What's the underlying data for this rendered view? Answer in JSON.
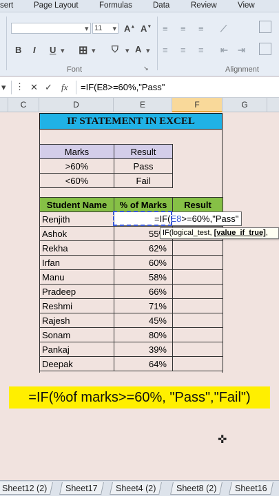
{
  "ribbon_tabs": [
    "sert",
    "Page Layout",
    "Formulas",
    "Data",
    "Review",
    "View"
  ],
  "font_size": "11",
  "group_labels": {
    "font": "Font",
    "alignment": "Alignment"
  },
  "formula_bar": {
    "fx": "fx",
    "formula": "=IF(E8>=60%,\"Pass\""
  },
  "columns": [
    "C",
    "D",
    "E",
    "F",
    "G"
  ],
  "sheet_title": "IF STATEMENT IN EXCEL",
  "criteria": {
    "headers": [
      "Marks",
      "Result"
    ],
    "rows": [
      [
        ">60%",
        "Pass"
      ],
      [
        "<60%",
        "Fail"
      ]
    ]
  },
  "students": {
    "headers": [
      "Student Name",
      "% of Marks",
      "Result"
    ],
    "rows": [
      [
        "Renjith",
        ""
      ],
      [
        "Ashok",
        "55%"
      ],
      [
        "Rekha",
        "62%"
      ],
      [
        "Irfan",
        "60%"
      ],
      [
        "Manu",
        "58%"
      ],
      [
        "Pradeep",
        "66%"
      ],
      [
        "Reshmi",
        "71%"
      ],
      [
        "Rajesh",
        "45%"
      ],
      [
        "Sonam",
        "80%"
      ],
      [
        "Pankaj",
        "39%"
      ],
      [
        "Deepak",
        "64%"
      ]
    ]
  },
  "edit_cell": {
    "prefix": "=IF(",
    "ref": "E8",
    "suffix": ">=60%,\"Pass\""
  },
  "tooltip": {
    "fn": "IF(logical_test, ",
    "bold_arg": "[value_if_true]",
    "rest": ", "
  },
  "banner": "=IF(%of marks>=60%, \"Pass\",\"Fail\")",
  "sheet_tabs": [
    "Sheet12 (2)",
    "Sheet17",
    "Sheet4 (2)",
    "Sheet8 (2)",
    "Sheet16"
  ],
  "colors": {
    "title_band": "#20b2e6",
    "header_green": "#86c046",
    "criteria_header": "#d3cde9",
    "banner": "#ffef00",
    "background": "#f1e3df"
  }
}
